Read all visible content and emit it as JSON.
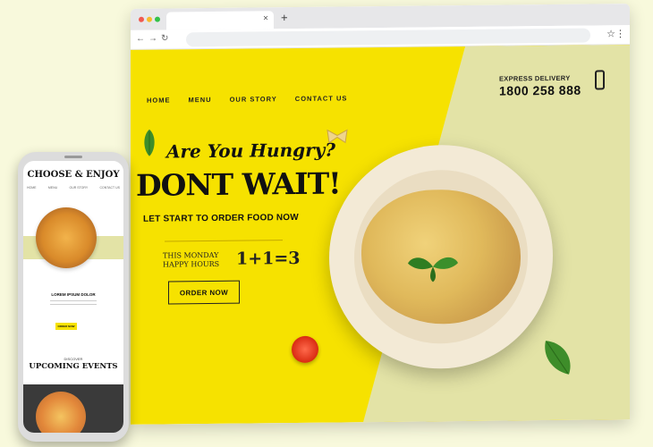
{
  "site": {
    "nav": [
      "HOME",
      "MENU",
      "OUR STORY",
      "CONTACT US"
    ],
    "delivery_label": "EXPRESS DELIVERY",
    "phone_number": "1800 258 888",
    "hero_small": "Are You Hungry?",
    "hero_big": "DONT WAIT!",
    "subtitle": "LET START TO ORDER FOOD NOW",
    "promo_line1": "THIS MONDAY",
    "promo_line2": "HAPPY HOURS",
    "promo_offer": "1+1=3",
    "order_button": "ORDER NOW"
  },
  "mobile": {
    "title": "CHOOSE & ENJOY",
    "item_name": "LOREM IPSUM DOLOR",
    "order_button": "ORDER NOW",
    "discover": "DISCOVER",
    "events_title": "UPCOMING EVENTS"
  },
  "colors": {
    "yellow": "#f6e200",
    "sage": "#e3e3a6",
    "background": "#f8f9dc"
  },
  "icons": [
    "tab-close-icon",
    "new-tab-icon",
    "back-icon",
    "forward-icon",
    "reload-icon",
    "star-icon",
    "menu-kebab-icon",
    "phone-icon",
    "basil-leaf-icon",
    "tomato-icon",
    "farfalle-icon"
  ]
}
